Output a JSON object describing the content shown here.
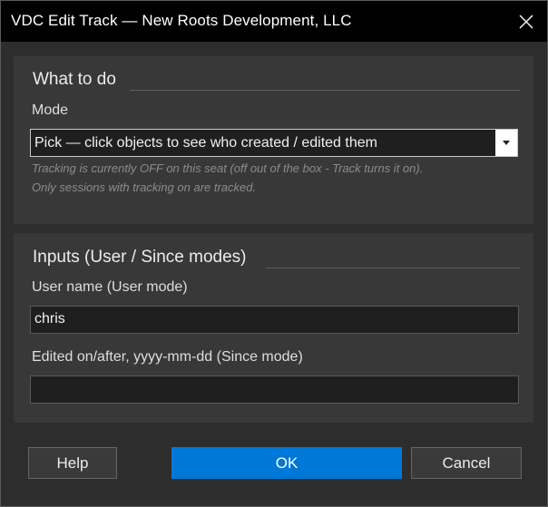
{
  "window": {
    "title": "VDC Edit Track — New Roots Development, LLC",
    "close_icon": "close-icon"
  },
  "what_to_do": {
    "heading": "What to do",
    "mode_label": "Mode",
    "mode_value": "Pick — click objects to see who created / edited them",
    "mode_hint_line1": "Tracking is currently OFF on this seat (off out of the box - Track turns it on).",
    "mode_hint_line2": "Only sessions with tracking on are tracked."
  },
  "inputs": {
    "heading": "Inputs (User / Since modes)",
    "user_label": "User name (User mode)",
    "user_value": "chris",
    "since_label": "Edited on/after, yyyy-mm-dd (Since mode)",
    "since_value": ""
  },
  "buttons": {
    "help": "Help",
    "ok": "OK",
    "cancel": "Cancel"
  },
  "colors": {
    "accent": "#0078d7",
    "background": "#2d2d2d",
    "group_background": "#383838",
    "titlebar": "#000000"
  }
}
